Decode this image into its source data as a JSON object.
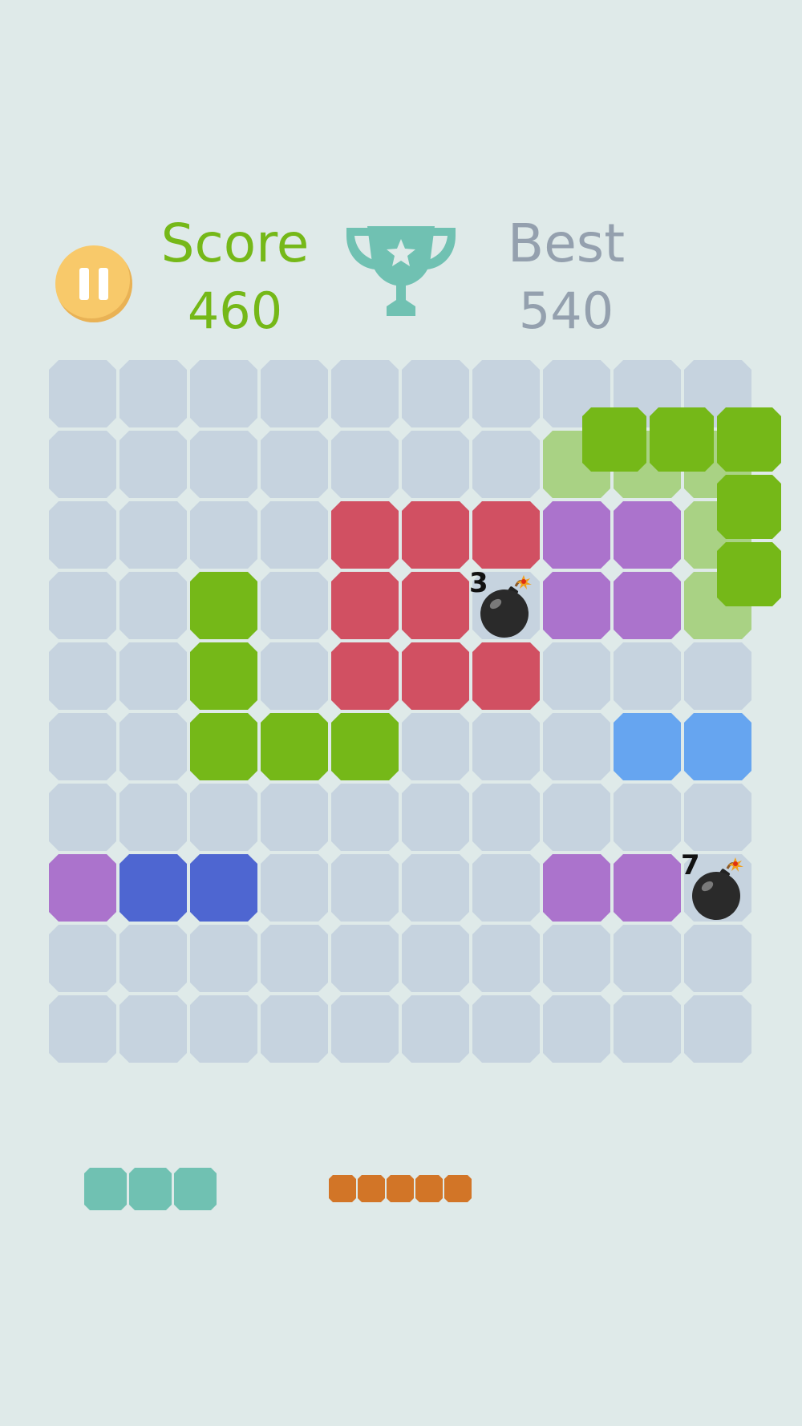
{
  "header": {
    "pause_icon": "pause-icon",
    "score_label": "Score",
    "score_value": "460",
    "trophy_icon": "trophy-icon",
    "best_label": "Best",
    "best_value": "540"
  },
  "colors": {
    "background": "#dfeae9",
    "empty_cell": "#c6d3df",
    "red": "#d15062",
    "green": "#75b818",
    "purple": "#ab73cc",
    "light_blue": "#66a5f0",
    "dark_blue": "#4e66d1",
    "teal": "#70c1b2",
    "orange": "#d27527",
    "ghost_green": "#a9d284",
    "score_text": "#75b818",
    "best_text": "#94a0ae",
    "pause_button": "#f8c96a"
  },
  "board": {
    "rows": 10,
    "cols": 10,
    "filled_cells": [
      {
        "row": 2,
        "col": 4,
        "color": "red"
      },
      {
        "row": 2,
        "col": 5,
        "color": "red"
      },
      {
        "row": 2,
        "col": 6,
        "color": "red"
      },
      {
        "row": 2,
        "col": 7,
        "color": "purple"
      },
      {
        "row": 2,
        "col": 8,
        "color": "purple"
      },
      {
        "row": 3,
        "col": 2,
        "color": "green"
      },
      {
        "row": 3,
        "col": 4,
        "color": "red"
      },
      {
        "row": 3,
        "col": 5,
        "color": "red"
      },
      {
        "row": 3,
        "col": 7,
        "color": "purple"
      },
      {
        "row": 3,
        "col": 8,
        "color": "purple"
      },
      {
        "row": 4,
        "col": 2,
        "color": "green"
      },
      {
        "row": 4,
        "col": 4,
        "color": "red"
      },
      {
        "row": 4,
        "col": 5,
        "color": "red"
      },
      {
        "row": 4,
        "col": 6,
        "color": "red"
      },
      {
        "row": 5,
        "col": 2,
        "color": "green"
      },
      {
        "row": 5,
        "col": 3,
        "color": "green"
      },
      {
        "row": 5,
        "col": 4,
        "color": "green"
      },
      {
        "row": 5,
        "col": 8,
        "color": "light_blue"
      },
      {
        "row": 5,
        "col": 9,
        "color": "light_blue"
      },
      {
        "row": 7,
        "col": 0,
        "color": "purple"
      },
      {
        "row": 7,
        "col": 1,
        "color": "dark_blue"
      },
      {
        "row": 7,
        "col": 2,
        "color": "dark_blue"
      },
      {
        "row": 7,
        "col": 7,
        "color": "purple"
      },
      {
        "row": 7,
        "col": 8,
        "color": "purple"
      }
    ],
    "ghost_cells": [
      {
        "row": 1,
        "col": 7
      },
      {
        "row": 1,
        "col": 8
      },
      {
        "row": 1,
        "col": 9
      },
      {
        "row": 2,
        "col": 9
      },
      {
        "row": 3,
        "col": 9
      }
    ],
    "bombs": [
      {
        "row": 3,
        "col": 6,
        "count": "3",
        "icon": "bomb-icon"
      },
      {
        "row": 7,
        "col": 9,
        "count": "7",
        "icon": "bomb-icon"
      }
    ]
  },
  "dragging_piece": {
    "color": "green",
    "shape": [
      [
        0,
        0
      ],
      [
        0,
        1
      ],
      [
        0,
        2
      ],
      [
        1,
        2
      ],
      [
        2,
        2
      ]
    ]
  },
  "tray": [
    {
      "color": "teal",
      "shape": [
        [
          0,
          0
        ],
        [
          0,
          1
        ],
        [
          0,
          2
        ]
      ]
    },
    {
      "color": "orange",
      "shape": [
        [
          0,
          0
        ],
        [
          0,
          1
        ],
        [
          0,
          2
        ],
        [
          0,
          3
        ],
        [
          0,
          4
        ]
      ]
    }
  ]
}
